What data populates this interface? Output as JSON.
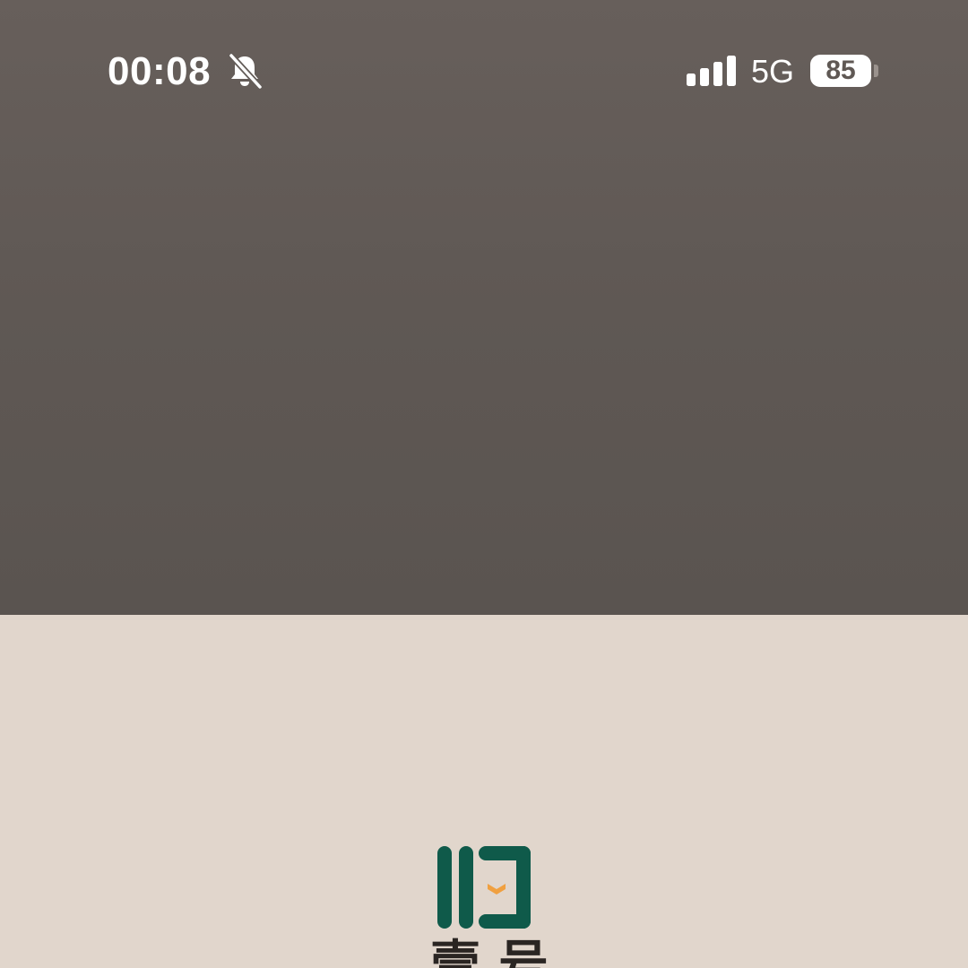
{
  "status_bar": {
    "time": "00:08",
    "mute_icon": "bell-slash-icon",
    "signal_icon": "cellular-signal-icon",
    "network": "5G",
    "battery_level": "85",
    "battery_icon": "battery-icon"
  },
  "logo": {
    "icon": "open-book-logo-icon",
    "text": "壹号",
    "colors": {
      "primary": "#0f5a4a",
      "accent": "#f0a040"
    }
  },
  "colors": {
    "top_panel": "#5f5854",
    "bottom_panel": "#e1d6cc"
  }
}
